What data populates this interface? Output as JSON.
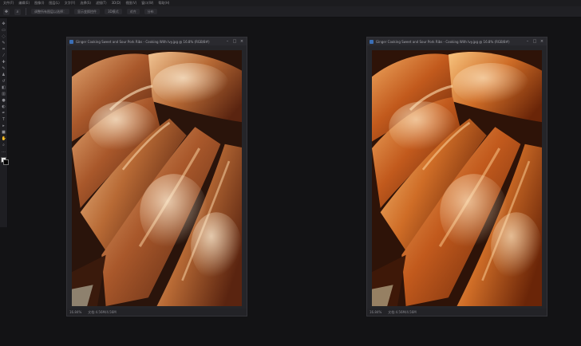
{
  "menubar": {
    "items": [
      "文件(F)",
      "编辑(E)",
      "图像(I)",
      "图层(L)",
      "文字(Y)",
      "选择(S)",
      "滤镜(T)",
      "3D(D)",
      "视图(V)",
      "窗口(W)",
      "帮助(H)"
    ]
  },
  "options_bar": {
    "fields": [
      "调整所有图层以选择：",
      "显示变换控件",
      "3D模式",
      "对齐",
      "分布"
    ]
  },
  "tools": [
    {
      "icon": "move-icon",
      "glyph": "✥"
    },
    {
      "icon": "marquee-icon",
      "glyph": "▭"
    },
    {
      "icon": "lasso-icon",
      "glyph": "◌"
    },
    {
      "icon": "quick-select-icon",
      "glyph": "✎"
    },
    {
      "icon": "crop-icon",
      "glyph": "⌗"
    },
    {
      "icon": "eyedropper-icon",
      "glyph": "⁄"
    },
    {
      "icon": "healing-brush-icon",
      "glyph": "✚"
    },
    {
      "icon": "brush-icon",
      "glyph": "✎"
    },
    {
      "icon": "clone-stamp-icon",
      "glyph": "♟"
    },
    {
      "icon": "history-brush-icon",
      "glyph": "↺"
    },
    {
      "icon": "eraser-icon",
      "glyph": "◧"
    },
    {
      "icon": "gradient-icon",
      "glyph": "▥"
    },
    {
      "icon": "blur-icon",
      "glyph": "●"
    },
    {
      "icon": "dodge-icon",
      "glyph": "◐"
    },
    {
      "icon": "pen-icon",
      "glyph": "✒"
    },
    {
      "icon": "type-icon",
      "glyph": "T"
    },
    {
      "icon": "path-select-icon",
      "glyph": "▸"
    },
    {
      "icon": "shape-icon",
      "glyph": "■"
    },
    {
      "icon": "hand-icon",
      "glyph": "✋"
    },
    {
      "icon": "zoom-icon",
      "glyph": "⌕"
    },
    {
      "icon": "more-tools-icon",
      "glyph": "…"
    }
  ],
  "documents": [
    {
      "title": "Ginger Cooking Sweet and Sour Pork Ribs - Cooking With Ivy.jpg @ 16.8% (RGB/8#)",
      "zoom": "16.84%",
      "info": "文档:4.56M/4.56M",
      "tone": "original"
    },
    {
      "title": "Ginger Cooking Sweet and Sour Pork Ribs - Cooking With Ivy.jpg @ 16.8% (RGB/8#)",
      "zoom": "16.84%",
      "info": "文档:4.56M/4.56M",
      "tone": "warm"
    }
  ],
  "colors": {
    "workspace": "#131315",
    "accent_ps": "#3b6fb6"
  }
}
